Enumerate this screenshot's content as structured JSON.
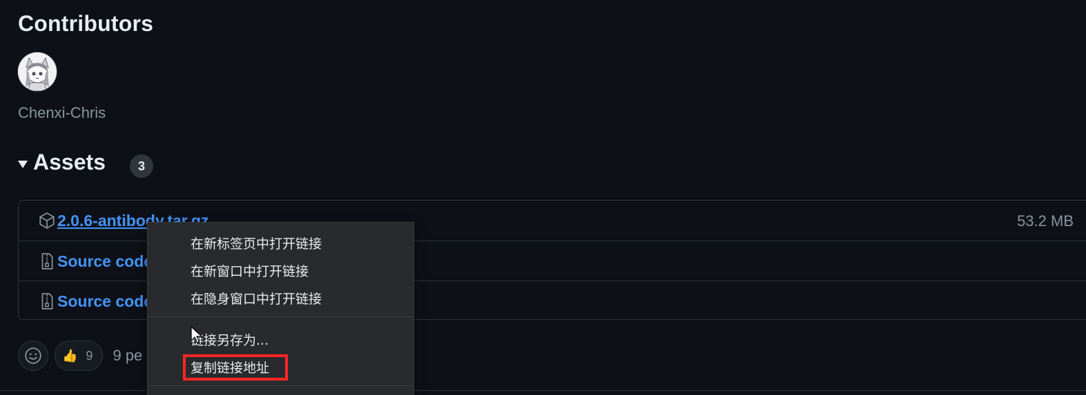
{
  "contributors": {
    "title": "Contributors",
    "users": [
      {
        "name": "Chenxi-Chris"
      }
    ]
  },
  "assets": {
    "title": "Assets",
    "count": "3",
    "items": [
      {
        "name": "2.0.6-antibody.tar.gz",
        "size": "53.2 MB",
        "icon": "package-icon"
      },
      {
        "name": "Source code",
        "icon": "file-zip-icon"
      },
      {
        "name": "Source code",
        "icon": "file-zip-icon"
      }
    ]
  },
  "reactions": {
    "thumbs_up_count": "9",
    "reacted_text": "9 pe"
  },
  "context_menu": {
    "items": [
      "在新标签页中打开链接",
      "在新窗口中打开链接",
      "在隐身窗口中打开链接",
      "链接另存为...",
      "复制链接地址"
    ],
    "highlighted_item": "复制链接地址",
    "highlight_color": "#ff2525"
  },
  "colors": {
    "background": "#0d1117",
    "link": "#4493f8",
    "muted": "#8b949e",
    "menu_bg": "#292a2d"
  }
}
